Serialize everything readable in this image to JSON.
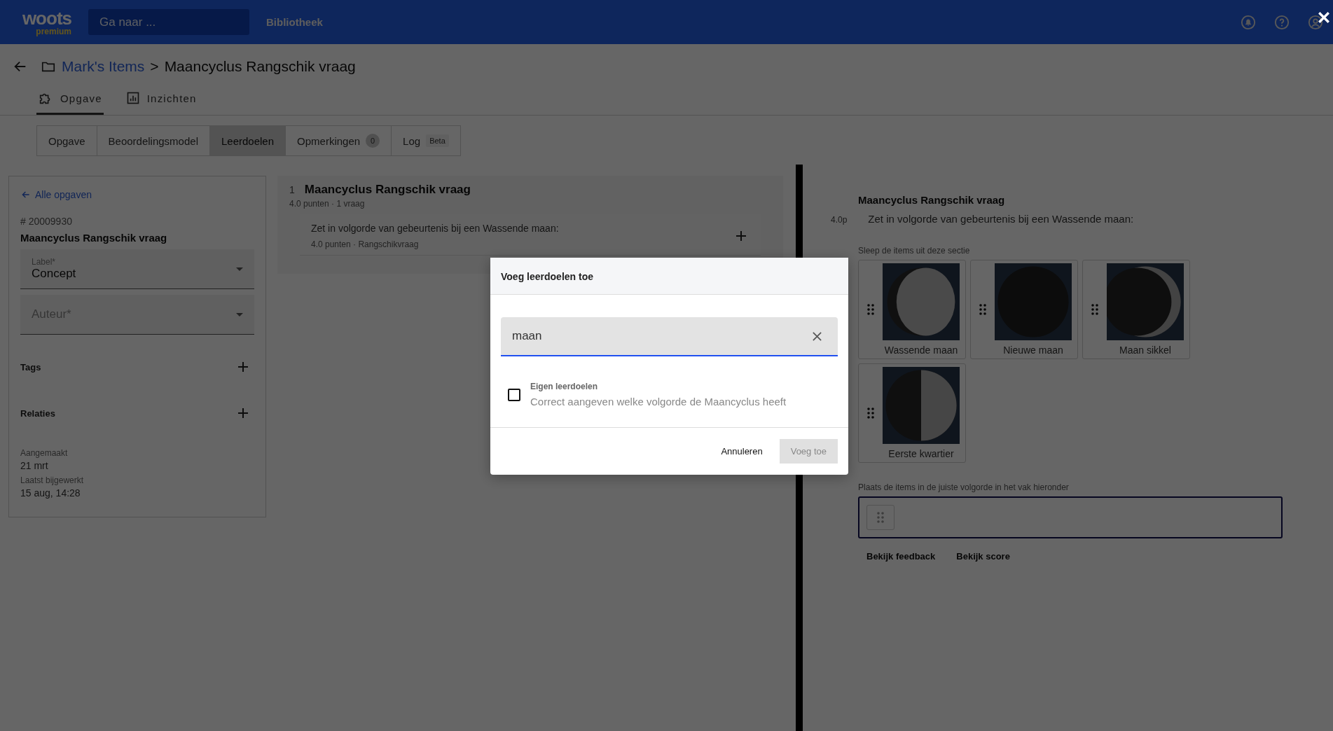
{
  "topbar": {
    "logo": "woots",
    "logo_sub": "premium",
    "search": {
      "placeholder": "Ga naar ..."
    },
    "nav": [
      "Bibliotheek"
    ]
  },
  "breadcrumb": {
    "folder": "Mark's Items",
    "separator": ">",
    "current": "Maancyclus Rangschik vraag"
  },
  "main_tabs": [
    {
      "label": "Opgave",
      "kind": "puzzle",
      "selected": true
    },
    {
      "label": "Inzichten",
      "kind": "chart",
      "selected": false
    }
  ],
  "sub_tabs": [
    {
      "label": "Opgave",
      "selected": false
    },
    {
      "label": "Beoordelingsmodel",
      "selected": false
    },
    {
      "label": "Leerdoelen",
      "selected": true
    },
    {
      "label": "Opmerkingen",
      "badge": "0",
      "kind": "count",
      "selected": false
    },
    {
      "label": "Log",
      "badge": "Beta",
      "kind": "tag",
      "selected": false
    }
  ],
  "sidebar": {
    "back_link": "Alle opgaven",
    "id": "# 20009930",
    "title": "Maancyclus Rangschik vraag",
    "fields": [
      {
        "label": "Label*",
        "value": "Concept"
      },
      {
        "placeholder": "Auteur*"
      }
    ],
    "sections": [
      "Tags",
      "Relaties"
    ],
    "meta": [
      {
        "label": "Aangemaakt",
        "value": "21 mrt"
      },
      {
        "label": "Laatst bijgewerkt",
        "value": "15 aug, 14:28"
      }
    ]
  },
  "question_list": {
    "number": "1",
    "title": "Maancyclus Rangschik vraag",
    "meta": "4.0 punten · 1 vraag",
    "questions": [
      {
        "text": "Zet in volgorde van gebeurtenis bij een Wassende maan:",
        "meta": "4.0 punten · Rangschikvraag"
      }
    ]
  },
  "preview": {
    "title": "Maancyclus Rangschik vraag",
    "points": "4.0p",
    "prompt": "Zet in volgorde van gebeurtenis bij een Wassende maan:",
    "source_label": "Sleep de items uit deze sectie",
    "items": [
      {
        "label": "Wassende maan",
        "kind": "gibbous"
      },
      {
        "label": "Nieuwe maan",
        "kind": "new"
      },
      {
        "label": "Maan sikkel",
        "kind": "crescent"
      },
      {
        "label": "Eerste kwartier",
        "kind": "quarter"
      }
    ],
    "target_label": "Plaats de items in de juiste volgorde in het vak hieronder",
    "actions": [
      "Bekijk feedback",
      "Bekijk score"
    ]
  },
  "dialog": {
    "title": "Voeg leerdoelen toe",
    "search": {
      "value": "maan"
    },
    "options": [
      {
        "group": "Eigen leerdoelen",
        "text": "Correct aangeven welke volgorde de Maancyclus heeft",
        "checked": false
      }
    ],
    "buttons": [
      {
        "label": "Annuleren",
        "disabled": false
      },
      {
        "label": "Voeg toe",
        "disabled": true
      }
    ]
  }
}
